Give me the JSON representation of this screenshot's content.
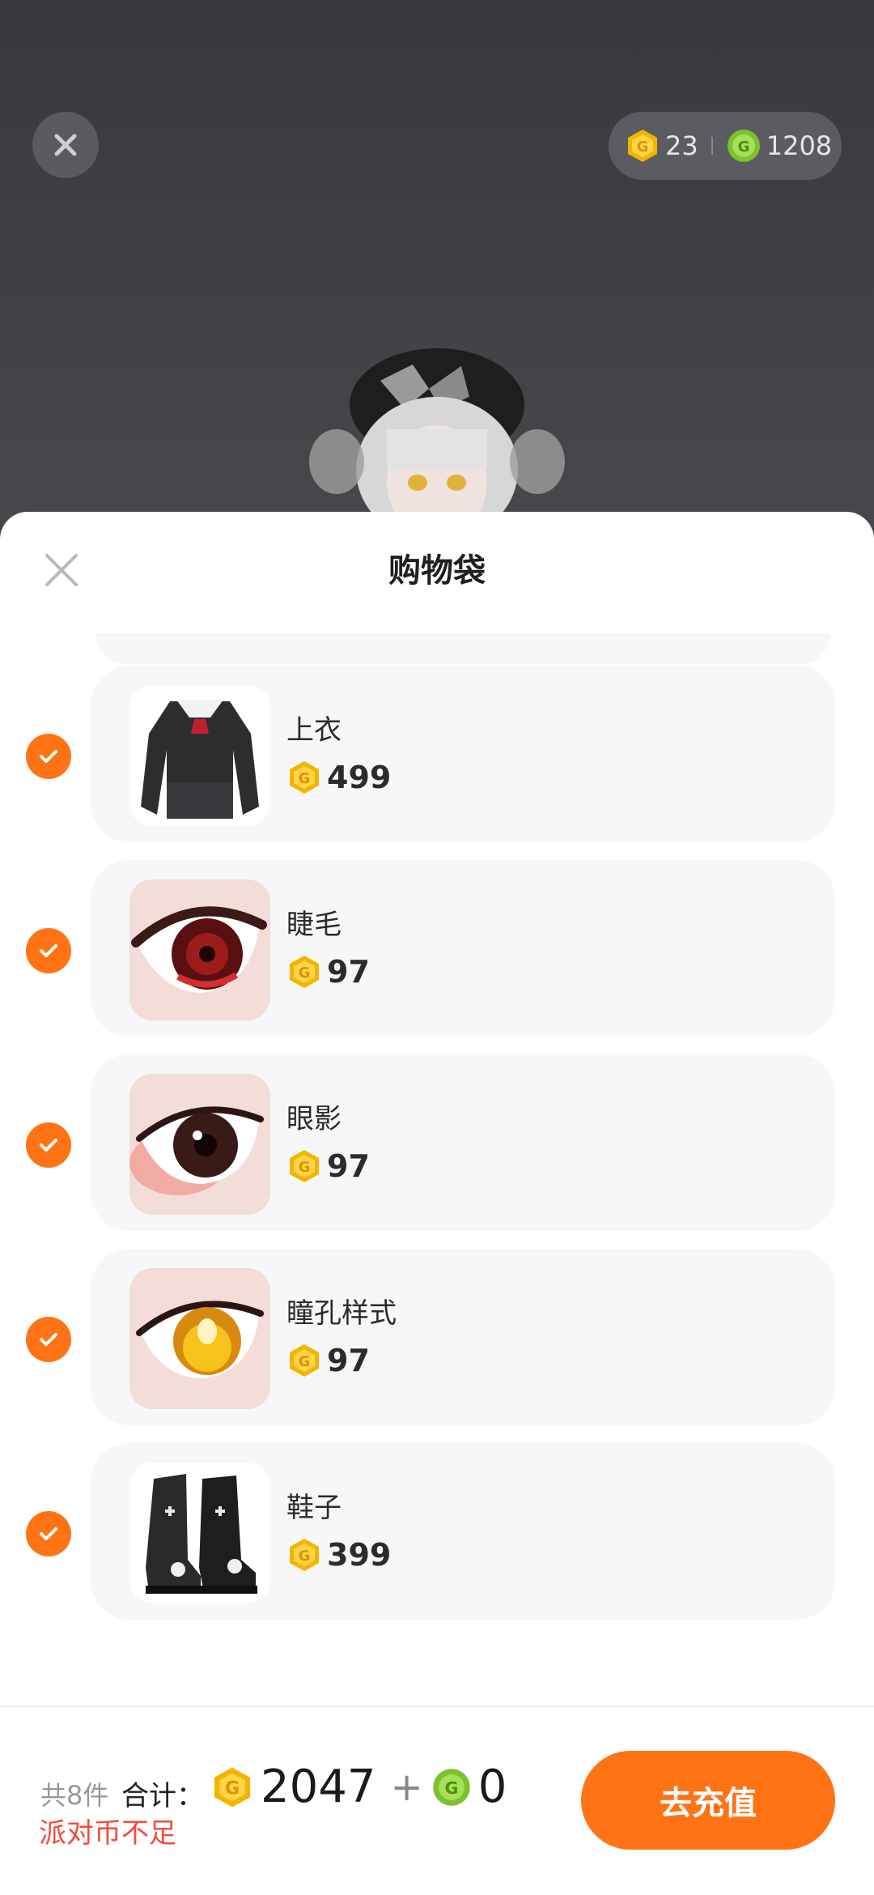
{
  "top_bar": {
    "gold_coins": "23",
    "green_coins": "1208"
  },
  "sheet": {
    "title": "购物袋"
  },
  "items": [
    {
      "name": "上衣",
      "price": "499",
      "icon": "shirt-thumbnail"
    },
    {
      "name": "睫毛",
      "price": "97",
      "icon": "eyelash-thumbnail"
    },
    {
      "name": "眼影",
      "price": "97",
      "icon": "eyeshadow-thumbnail"
    },
    {
      "name": "瞳孔样式",
      "price": "97",
      "icon": "pupil-thumbnail"
    },
    {
      "name": "鞋子",
      "price": "399",
      "icon": "shoes-thumbnail"
    }
  ],
  "footer": {
    "count": "共8件",
    "total_label": "合计：",
    "gold_total": "2047",
    "plus": "+",
    "green_total": "0",
    "warning": "派对币不足",
    "recharge_button": "去充值"
  },
  "colors": {
    "accent": "#ff7315",
    "warning": "#f04d3a",
    "gold": "#f4b400",
    "green": "#7cc22e"
  }
}
